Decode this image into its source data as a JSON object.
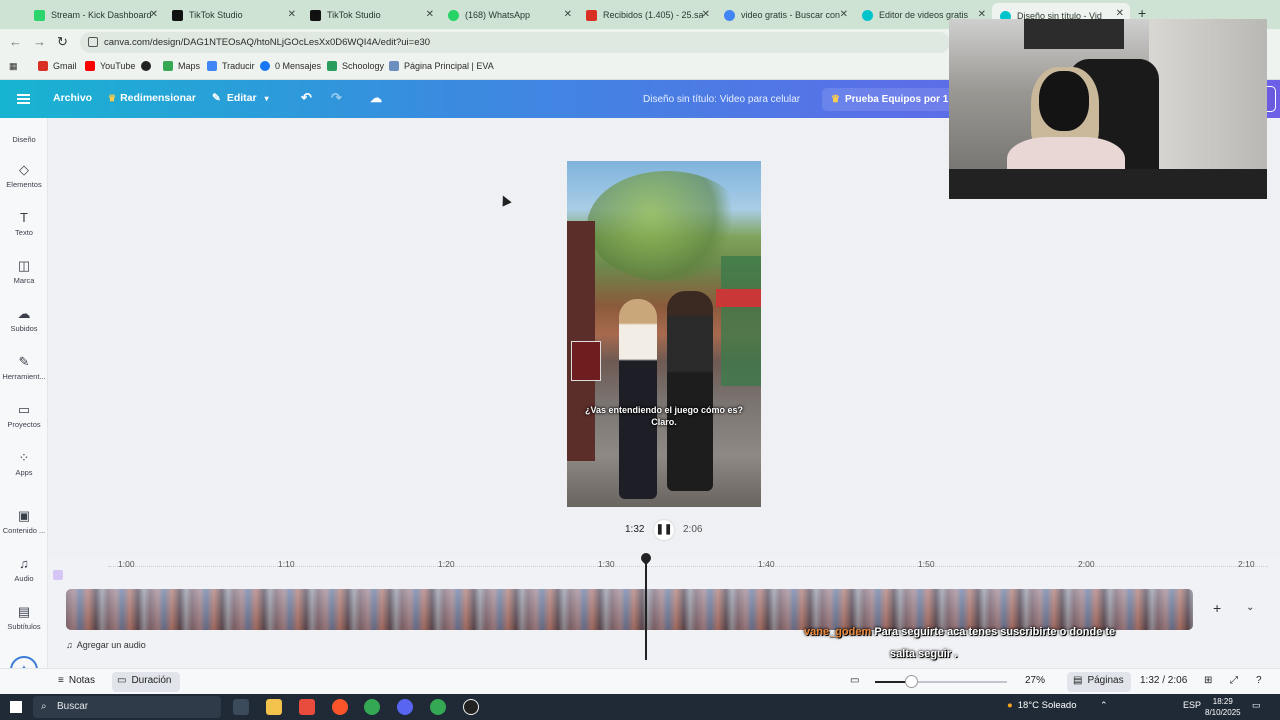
{
  "browser": {
    "tabs": [
      {
        "title": "Stream - Kick Dashboard",
        "icon": "kick-icon",
        "color": "#2bd56b"
      },
      {
        "title": "TikTok Studio",
        "icon": "tiktok-icon",
        "color": "#111111"
      },
      {
        "title": "TikTok Studio",
        "icon": "tiktok-icon",
        "color": "#111111"
      },
      {
        "title": "(168) WhatsApp",
        "icon": "whatsapp-icon",
        "color": "#25d366"
      },
      {
        "title": "Recibidos (1.405) - 25.sal",
        "icon": "gmail-icon",
        "color": "#d93025"
      },
      {
        "title": "video gratis - Buscar con",
        "icon": "google-icon",
        "color": "#4285f4"
      },
      {
        "title": "Editor de videos gratis",
        "icon": "canva-icon",
        "color": "#00c4cc"
      },
      {
        "title": "Diseño sin título - Vid",
        "icon": "canva-icon",
        "color": "#00c4cc"
      }
    ],
    "url": "canva.com/design/DAG1NTEOsAQ/htoNLjGOcLesXx0D6WQI4A/edit?ui=e30",
    "bookmarks": [
      "Gmail",
      "YouTube",
      "Maps",
      "Traducir",
      "0 Mensajes",
      "Schoology",
      "Página Principal | EVA"
    ]
  },
  "header": {
    "archivo": "Archivo",
    "redimensionar": "Redimensionar",
    "editar": "Editar",
    "design_title": "Diseño sin título: Video para celular",
    "teams_cta": "Prueba Equipos por 1 m"
  },
  "rail": {
    "diseno": "Diseño",
    "items": [
      "Elementos",
      "Texto",
      "Marca",
      "Subidos",
      "Herramient...",
      "Proyectos",
      "Apps",
      "Contenido ...",
      "Audio",
      "Subtítulos"
    ]
  },
  "video": {
    "caption": "¿Vas entendiendo el juego cómo es? Claro.",
    "current_time": "1:32",
    "total_time": "2:06"
  },
  "timeline": {
    "ticks": [
      "1:00",
      "1:10",
      "1:20",
      "1:30",
      "1:40",
      "1:50",
      "2:00",
      "2:10"
    ],
    "add_audio": "Agregar un audio"
  },
  "chat": {
    "user": "vane_godem",
    "message_line1": "Para seguirte aca tenes suscribirte o donde te",
    "message_line2": "salta seguir ."
  },
  "footer": {
    "notas": "Notas",
    "duracion": "Duración",
    "zoom": "27%",
    "paginas": "Páginas",
    "position": "1:32 / 2:06"
  },
  "taskbar": {
    "search": "Buscar",
    "weather": "18°C Soleado",
    "lang": "ESP",
    "time": "18:29",
    "date": "8/10/2025"
  }
}
